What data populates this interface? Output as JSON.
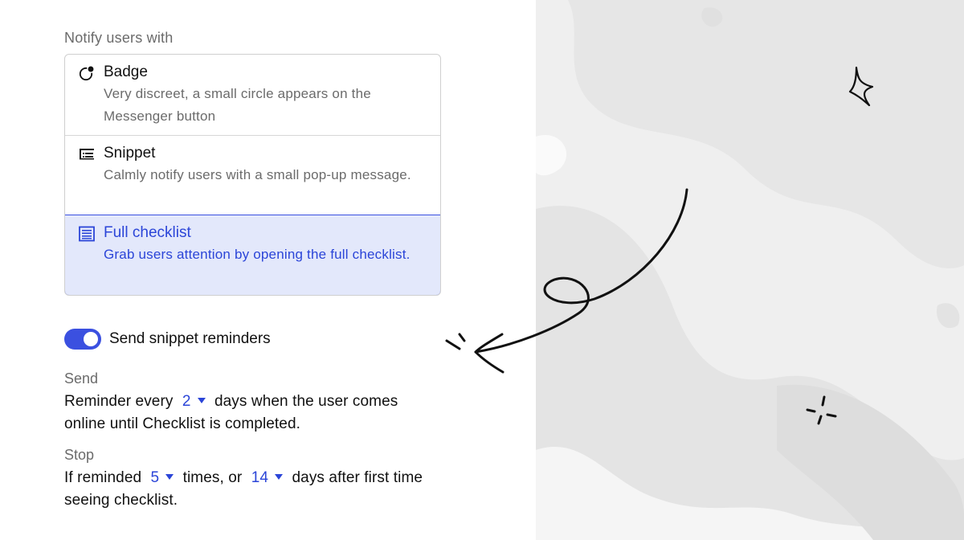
{
  "notify": {
    "label": "Notify users with",
    "options": [
      {
        "title": "Badge",
        "desc": "Very discreet, a small circle appears on the Messenger button",
        "icon": "badge-icon",
        "selected": false
      },
      {
        "title": "Snippet",
        "desc": "Calmly notify users with a small pop-up message.",
        "icon": "snippet-icon",
        "selected": false
      },
      {
        "title": "Full checklist",
        "desc": "Grab users attention by opening the full checklist.",
        "icon": "checklist-icon",
        "selected": true
      }
    ]
  },
  "reminders": {
    "toggle_label": "Send snippet reminders",
    "toggle_on": true
  },
  "send": {
    "label": "Send",
    "prefix": "Reminder every",
    "days_value": "2",
    "suffix": "days when the user comes online until Checklist is completed."
  },
  "stop": {
    "label": "Stop",
    "prefix": "If reminded",
    "times_value": "5",
    "middle": "times, or",
    "days_value": "14",
    "suffix": "days after first time seeing checklist."
  },
  "colors": {
    "accent": "#3b50e0",
    "selected_bg": "#e3e8fb",
    "muted_text": "#6b6b6b",
    "panel_bg": "#efefef"
  }
}
